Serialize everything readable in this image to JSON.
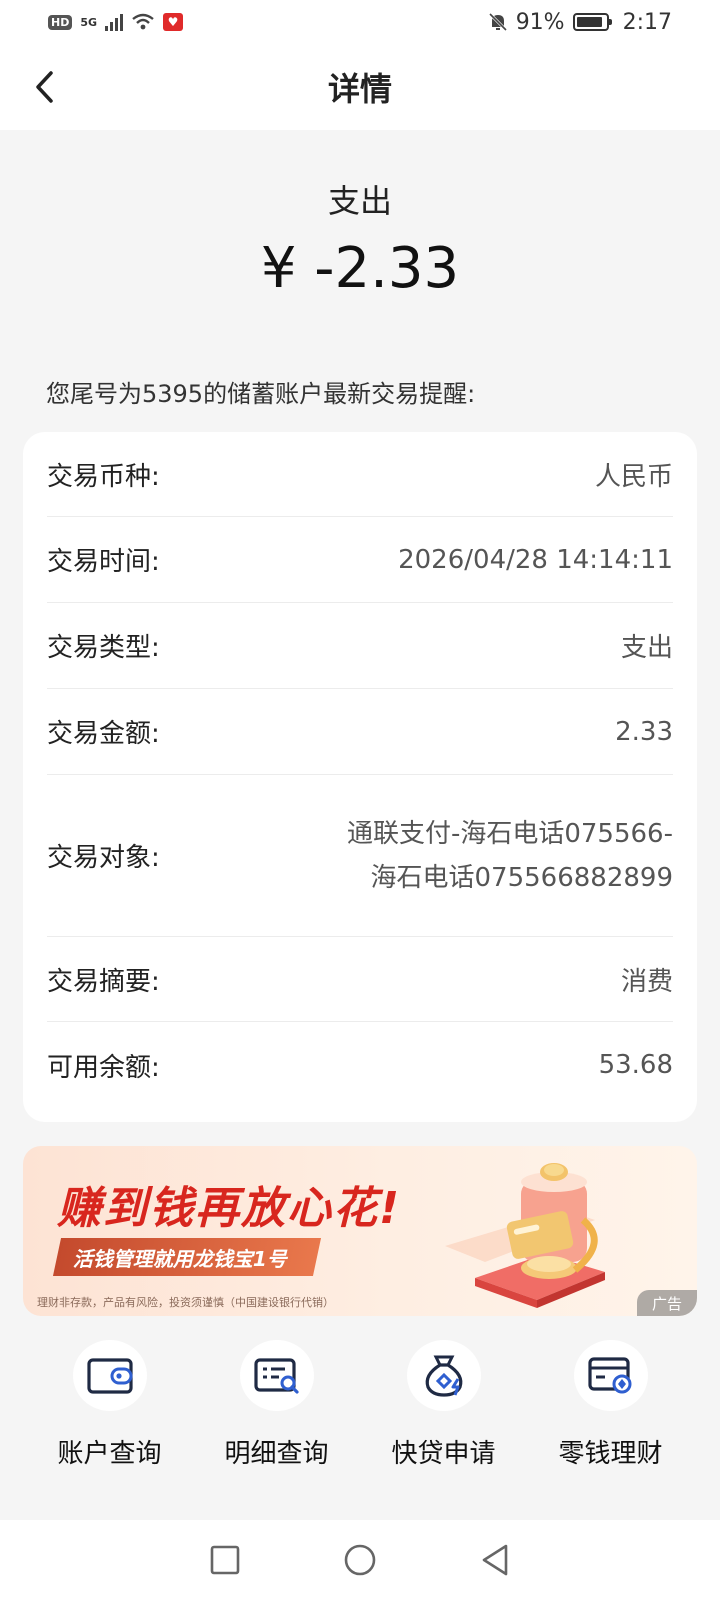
{
  "status_bar": {
    "hd": "HD",
    "network": "5G",
    "battery": "91%",
    "battery_level": 0.91,
    "time": "2:17"
  },
  "header": {
    "title": "详情",
    "back_icon": "chevron-left-icon"
  },
  "summary": {
    "type": "支出",
    "amount": "¥ -2.33"
  },
  "notice": "您尾号为5395的储蓄账户最新交易提醒:",
  "details": [
    {
      "label": "交易币种:",
      "value": "人民币"
    },
    {
      "label": "交易时间:",
      "value": "2026/04/28 14:14:11"
    },
    {
      "label": "交易类型:",
      "value": "支出"
    },
    {
      "label": "交易金额:",
      "value": "2.33"
    },
    {
      "label": "交易对象:",
      "value": "通联支付-海石电话075566-海石电话075566882899"
    },
    {
      "label": "交易摘要:",
      "value": "消费"
    },
    {
      "label": "可用余额:",
      "value": "53.68"
    }
  ],
  "banner": {
    "title": "赚到钱再放心花!",
    "subtitle": "活钱管理就用龙钱宝1号",
    "disclaimer": "理财非存款，产品有风险，投资须谨慎（中国建设银行代销）",
    "ad_label": "广告"
  },
  "actions": [
    {
      "label": "账户查询",
      "icon": "wallet-icon"
    },
    {
      "label": "明细查询",
      "icon": "statement-search-icon"
    },
    {
      "label": "快贷申请",
      "icon": "money-bag-icon"
    },
    {
      "label": "零钱理财",
      "icon": "card-coin-icon"
    }
  ],
  "colors": {
    "accent_red": "#d8261e",
    "icon_dark": "#1f2a44",
    "icon_blue": "#2f5fd0",
    "background": "#f5f5f5"
  }
}
